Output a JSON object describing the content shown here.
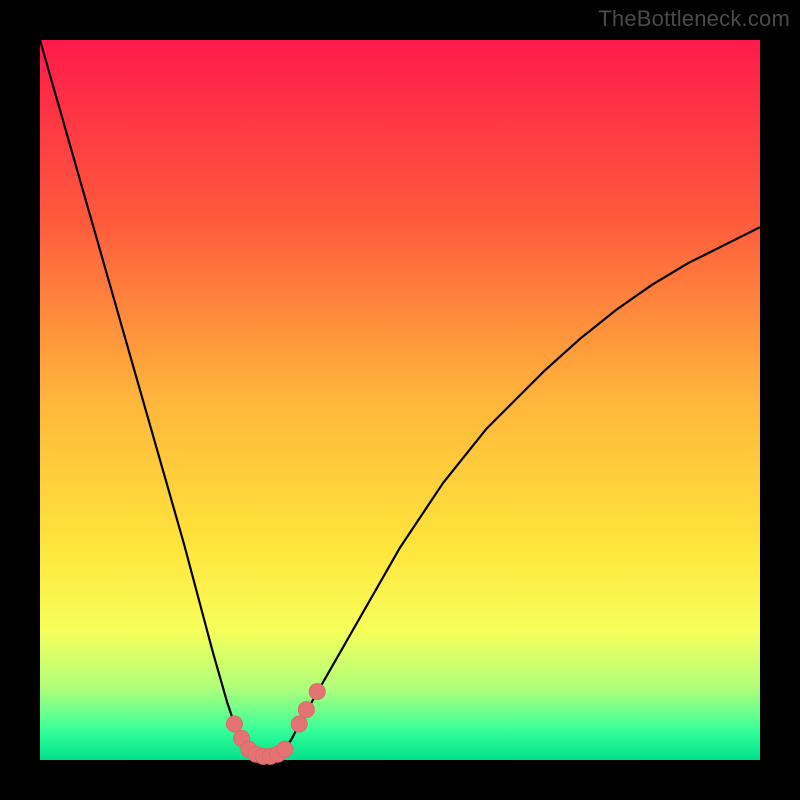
{
  "watermark": "TheBottleneck.com",
  "colors": {
    "background": "#000000",
    "curve_stroke": "#000000",
    "marker_fill": "#e57373",
    "marker_stroke": "#d86a6a"
  },
  "chart_data": {
    "type": "line",
    "title": "",
    "xlabel": "",
    "ylabel": "",
    "xlim": [
      0,
      100
    ],
    "ylim": [
      0,
      100
    ],
    "x": [
      0,
      2,
      4,
      6,
      8,
      10,
      12,
      14,
      16,
      18,
      20,
      22,
      24,
      26,
      27,
      28,
      29,
      30,
      31,
      32,
      33,
      34,
      35,
      36,
      38,
      40,
      42,
      44,
      46,
      48,
      50,
      52,
      54,
      56,
      58,
      60,
      62,
      64,
      66,
      68,
      70,
      75,
      80,
      85,
      90,
      95,
      100
    ],
    "series": [
      {
        "name": "bottleneck-curve",
        "values": [
          100,
          93,
          86,
          79,
          72,
          65,
          58,
          51,
          44,
          37,
          30,
          22.5,
          15,
          8,
          5,
          3,
          1.5,
          0.8,
          0.5,
          0.5,
          0.8,
          1.5,
          3,
          5,
          8.5,
          12,
          15.5,
          19,
          22.5,
          26,
          29.5,
          32.5,
          35.5,
          38.5,
          41,
          43.5,
          46,
          48,
          50,
          52,
          54,
          58.5,
          62.5,
          66,
          69,
          71.5,
          74
        ]
      }
    ],
    "markers": [
      {
        "x": 27,
        "y": 5
      },
      {
        "x": 28,
        "y": 3
      },
      {
        "x": 29,
        "y": 1.5
      },
      {
        "x": 30,
        "y": 0.8
      },
      {
        "x": 31,
        "y": 0.5
      },
      {
        "x": 32,
        "y": 0.5
      },
      {
        "x": 33,
        "y": 0.8
      },
      {
        "x": 34,
        "y": 1.5
      },
      {
        "x": 36,
        "y": 5
      },
      {
        "x": 37,
        "y": 7
      },
      {
        "x": 38.5,
        "y": 9.5
      }
    ],
    "marker_radius": 8
  }
}
